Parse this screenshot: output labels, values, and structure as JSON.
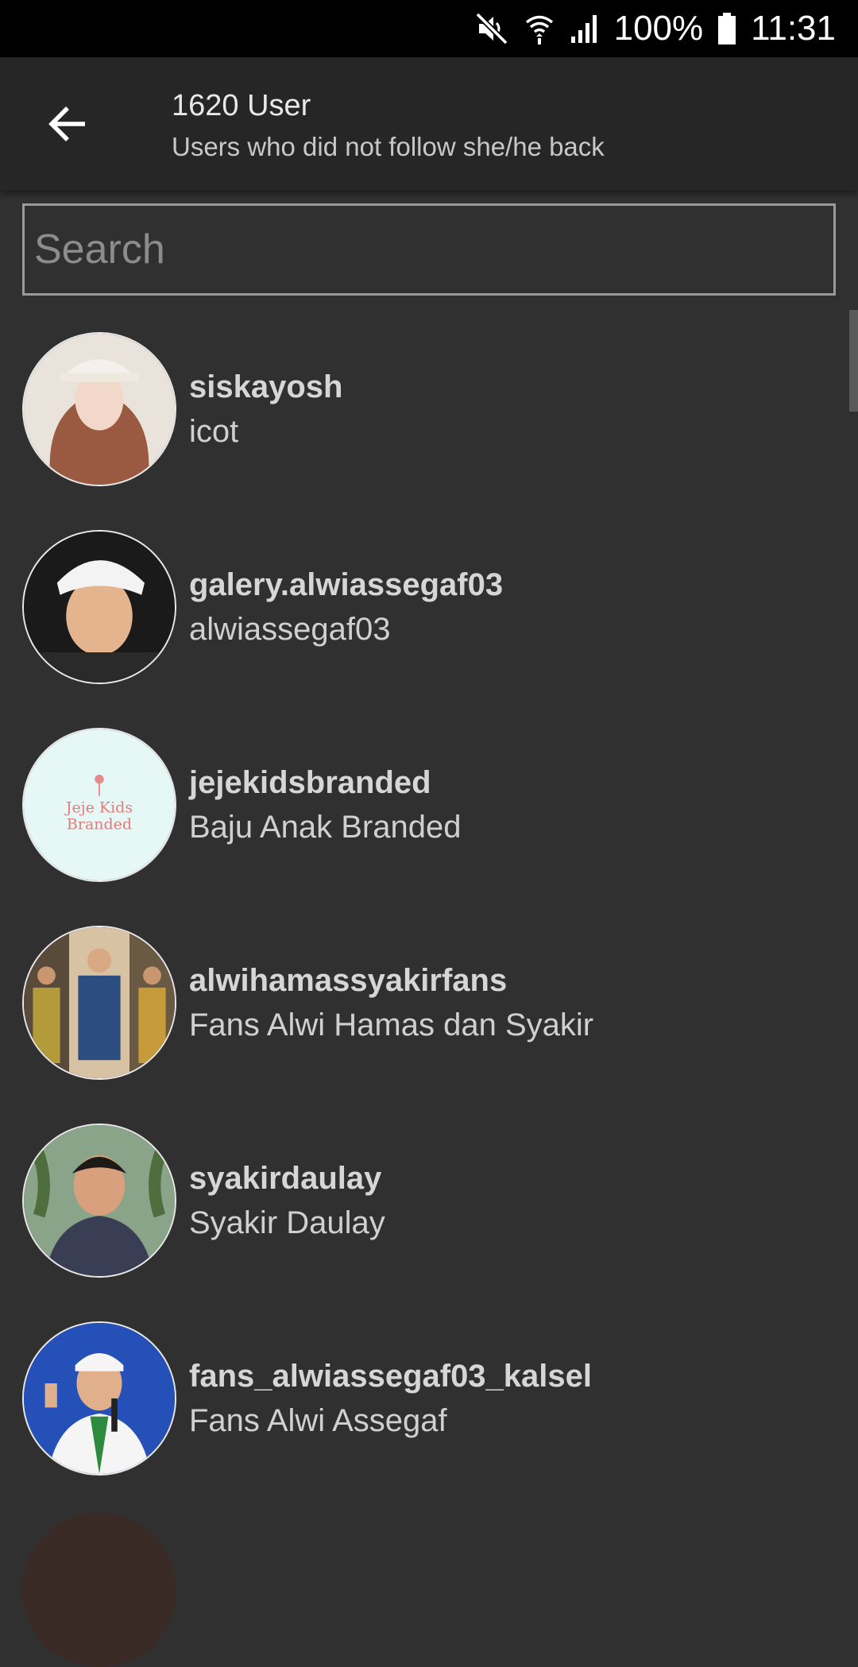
{
  "status_bar": {
    "battery_text": "100%",
    "time": "11:31",
    "icons": [
      "mute-icon",
      "wifi-icon",
      "signal-icon",
      "battery-icon"
    ]
  },
  "header": {
    "title": "1620 User",
    "subtitle": "Users who did not follow she/he back",
    "back_icon": "arrow-left-icon"
  },
  "search": {
    "placeholder": "Search",
    "value": ""
  },
  "users": [
    {
      "username": "siskayosh",
      "name": "icot"
    },
    {
      "username": "galery.alwiassegaf03",
      "name": "alwiassegaf03"
    },
    {
      "username": "jejekidsbranded",
      "name": "Baju Anak Branded"
    },
    {
      "username": "alwihamassyakirfans",
      "name": "Fans Alwi Hamas dan Syakir"
    },
    {
      "username": "syakirdaulay",
      "name": "Syakir Daulay"
    },
    {
      "username": "fans_alwiassegaf03_kalsel",
      "name": "Fans Alwi Assegaf"
    }
  ],
  "avatar_logo": {
    "line1": "Jeje Kids",
    "line2": "Branded"
  },
  "colors": {
    "background": "#303030",
    "app_bar": "#262626",
    "status_bar": "#000000"
  }
}
